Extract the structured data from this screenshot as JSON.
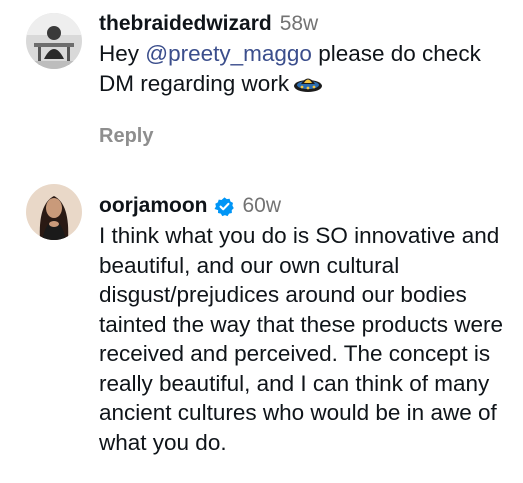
{
  "comments": [
    {
      "username": "thebraidedwizard",
      "time": "58w",
      "text_before": "Hey ",
      "mention": "@preety_maggo",
      "text_after": " please do check DM regarding work",
      "emoji_icon": "ufo-emoji-icon",
      "reply_label": "Reply"
    },
    {
      "username": "oorjamoon",
      "verified": true,
      "time": "60w",
      "text": "I think what you do is SO innovative and beautiful, and our own cultural disgust/prejudices around our bodies tainted the way that these products were received and perceived. The concept is really beautiful, and I can think of many ancient cultures who would be in awe of what you do."
    }
  ],
  "colors": {
    "mention": "#3b4e8c",
    "muted": "#737373",
    "verified": "#0095f6"
  }
}
